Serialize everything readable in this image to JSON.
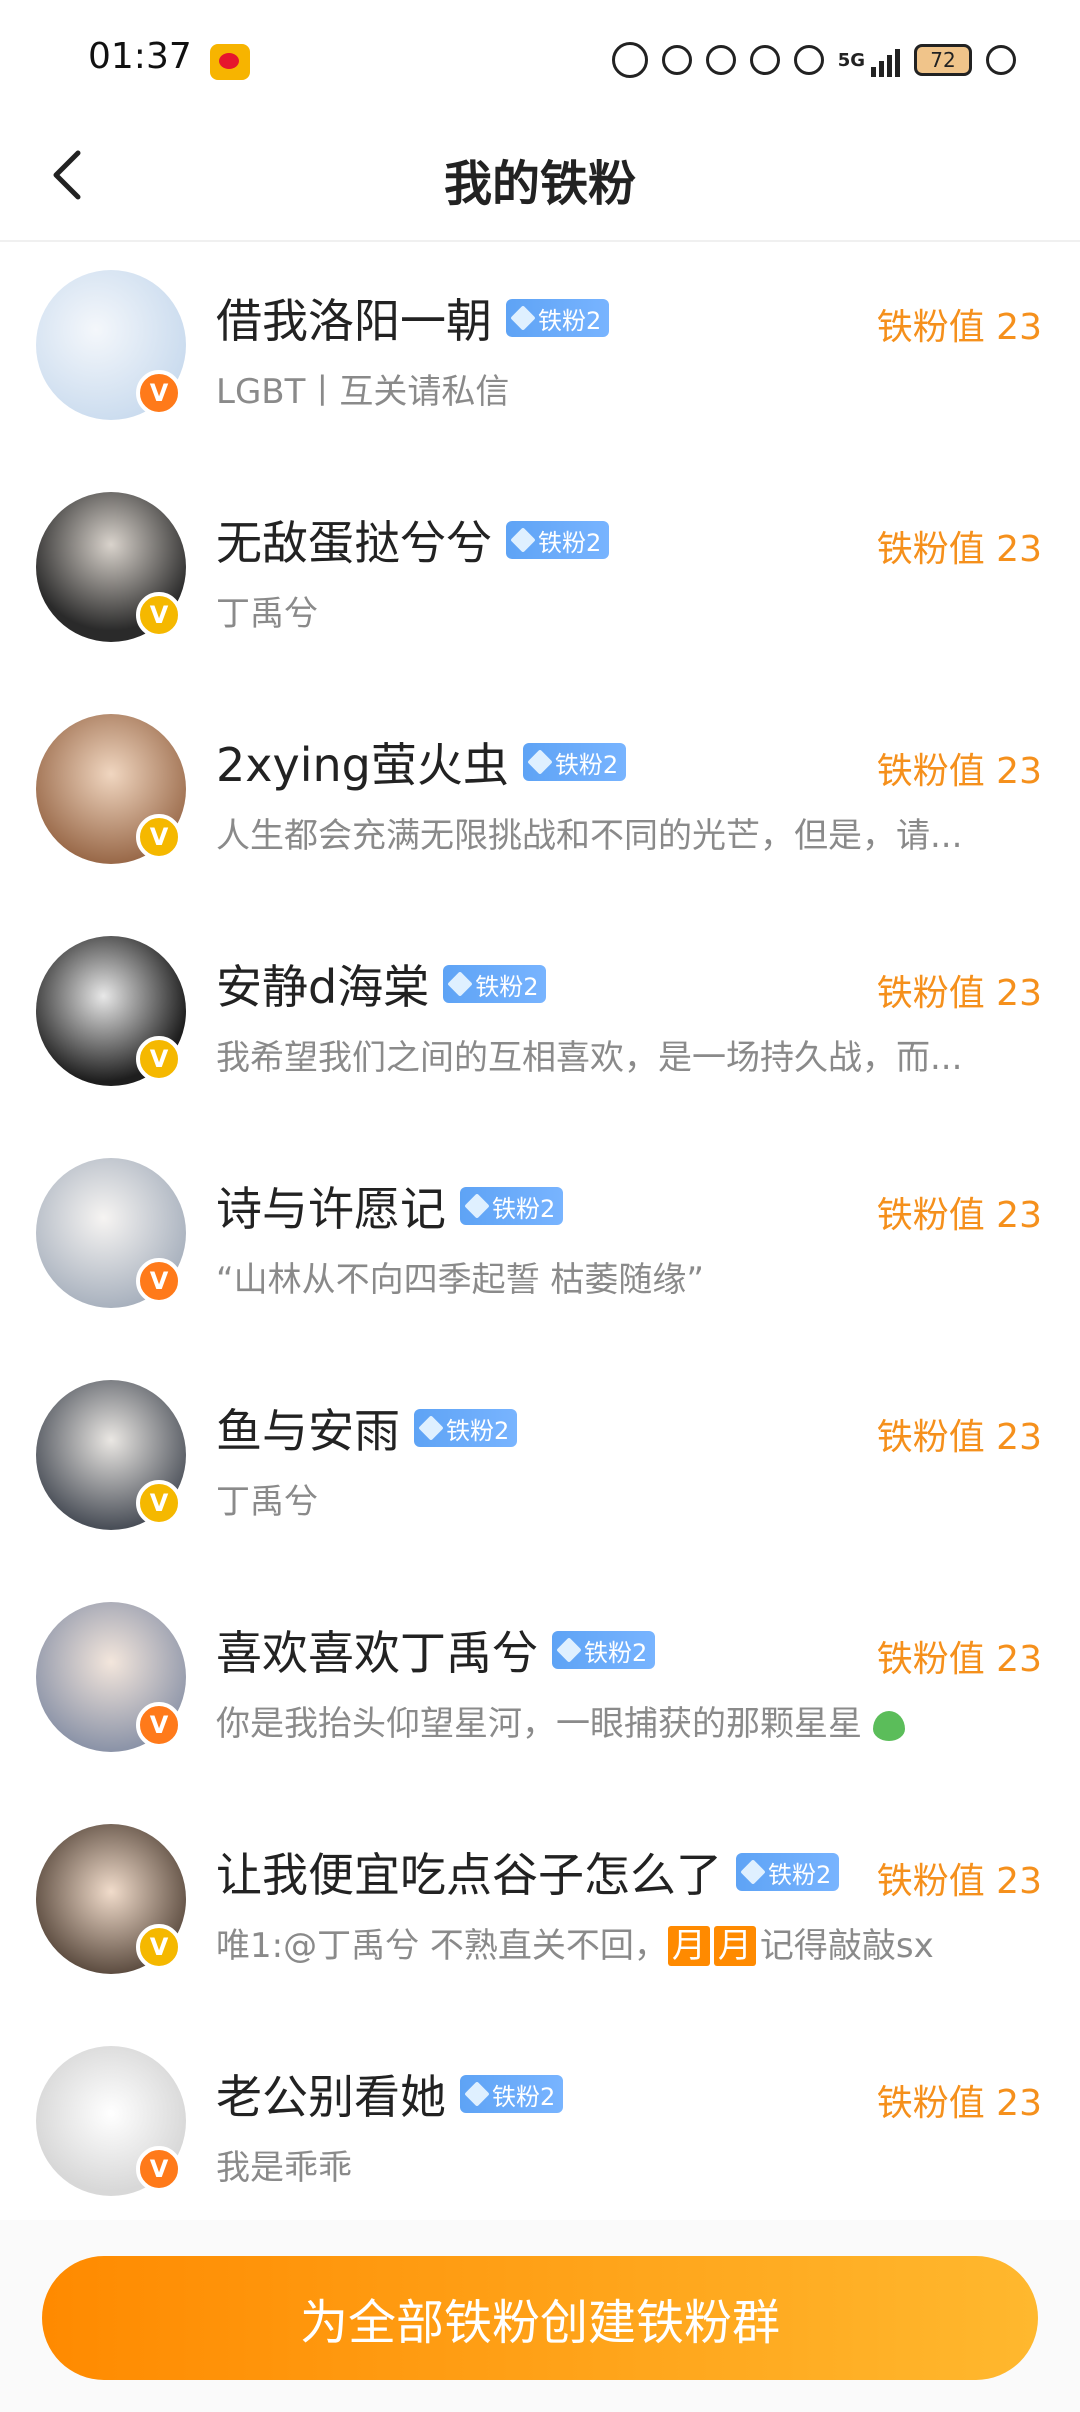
{
  "status_bar": {
    "time": "01:37",
    "network": "5G",
    "battery": "72"
  },
  "header": {
    "title": "我的铁粉"
  },
  "fans": [
    {
      "name": "借我洛阳一朝",
      "badge": "铁粉2",
      "value": "铁粉值 23",
      "desc": "LGBT丨互关请私信",
      "v_color": "orange",
      "avatar_color": "#cfe0f3"
    },
    {
      "name": "无敌蛋挞兮兮",
      "badge": "铁粉2",
      "value": "铁粉值 23",
      "desc": "丁禹兮",
      "v_color": "gold",
      "avatar_color": "#3a3a3a"
    },
    {
      "name": "2xying萤火虫",
      "badge": "铁粉2",
      "value": "铁粉值 23",
      "desc": "人生都会充满无限挑战和不同的光芒，但是，请...",
      "v_color": "gold",
      "avatar_color": "#b98a6a"
    },
    {
      "name": "安静d海棠",
      "badge": "铁粉2",
      "value": "铁粉值 23",
      "desc": "我希望我们之间的互相喜欢，是一场持久战，而...",
      "v_color": "gold",
      "avatar_color": "#2b2b2b"
    },
    {
      "name": "诗与许愿记",
      "badge": "铁粉2",
      "value": "铁粉值 23",
      "desc": "“山林从不向四季起誓 枯萎随缘”",
      "v_color": "orange",
      "avatar_color": "#d9dde3"
    },
    {
      "name": "鱼与安雨",
      "badge": "铁粉2",
      "value": "铁粉值 23",
      "desc": "丁禹兮",
      "v_color": "gold",
      "avatar_color": "#7a7f88"
    },
    {
      "name": "喜欢喜欢丁禹兮",
      "badge": "铁粉2",
      "value": "铁粉值 23",
      "desc": "你是我抬头仰望星河，一眼捕获的那颗星星",
      "v_color": "orange",
      "avatar_color": "#c8ccd6"
    },
    {
      "name": "让我便宜吃点谷子怎么了",
      "badge": "铁粉2",
      "value": "铁粉值 23",
      "desc_prefix": "唯1:@丁禹兮 不熟直关不回，",
      "desc_hl1": "月",
      "desc_hl2": "月",
      "desc_suffix": "记得敲敲sx",
      "v_color": "gold",
      "avatar_color": "#8a7a6a"
    },
    {
      "name": "老公别看她",
      "badge": "铁粉2",
      "value": "铁粉值 23",
      "desc": "我是乖乖",
      "v_color": "orange",
      "avatar_color": "#f2f2f2"
    }
  ],
  "bottom": {
    "button_label": "为全部铁粉创建铁粉群"
  },
  "colors": {
    "accent_orange": "#f5901c",
    "badge_blue": "#5ea3f5"
  }
}
